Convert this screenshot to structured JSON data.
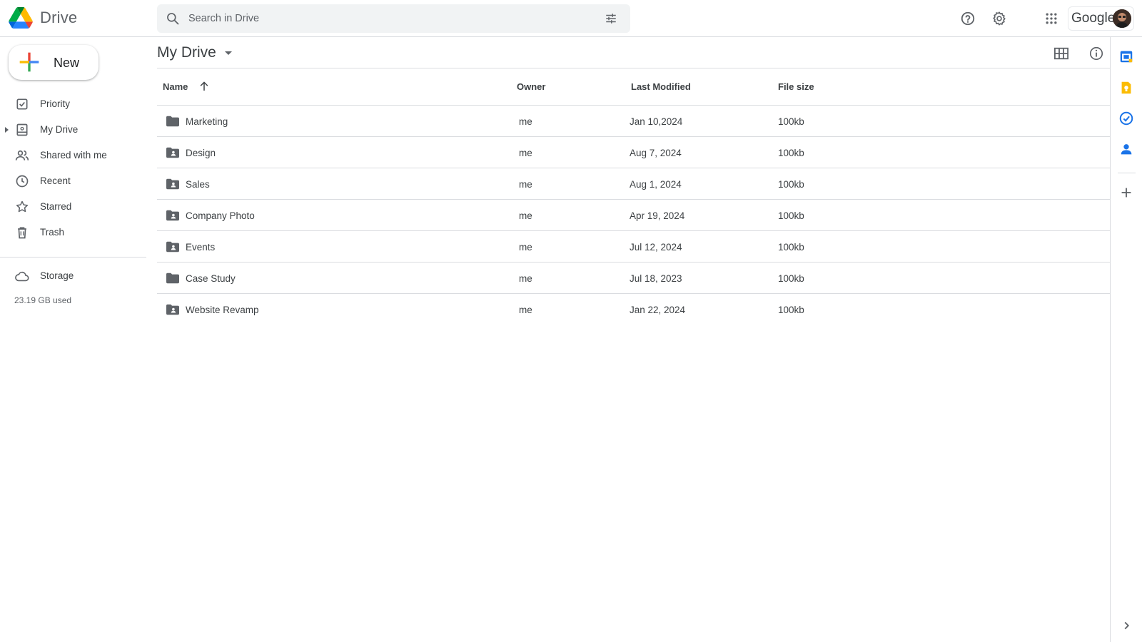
{
  "header": {
    "app_name": "Drive",
    "search_placeholder": "Search in Drive",
    "account_label": "Google"
  },
  "sidebar": {
    "new_label": "New",
    "items": [
      {
        "label": "Priority",
        "icon": "priority-icon"
      },
      {
        "label": "My Drive",
        "icon": "my-drive-icon"
      },
      {
        "label": "Shared with me",
        "icon": "shared-icon"
      },
      {
        "label": "Recent",
        "icon": "clock-icon"
      },
      {
        "label": "Starred",
        "icon": "star-icon"
      },
      {
        "label": "Trash",
        "icon": "trash-icon"
      }
    ],
    "storage_label": "Storage",
    "storage_used": "23.19 GB used"
  },
  "main": {
    "title": "My Drive",
    "columns": {
      "name": "Name",
      "owner": "Owner",
      "modified": "Last Modified",
      "size": "File size"
    },
    "rows": [
      {
        "name": "Marketing",
        "owner": "me",
        "modified": "Jan 10,2024",
        "size": "100kb",
        "shared": false
      },
      {
        "name": "Design",
        "owner": "me",
        "modified": "Aug 7, 2024",
        "size": "100kb",
        "shared": true
      },
      {
        "name": "Sales",
        "owner": "me",
        "modified": "Aug 1, 2024",
        "size": "100kb",
        "shared": true
      },
      {
        "name": "Company Photo",
        "owner": "me",
        "modified": "Apr 19, 2024",
        "size": "100kb",
        "shared": true
      },
      {
        "name": "Events",
        "owner": "me",
        "modified": "Jul 12, 2024",
        "size": "100kb",
        "shared": true
      },
      {
        "name": "Case Study",
        "owner": "me",
        "modified": "Jul 18, 2023",
        "size": "100kb",
        "shared": false
      },
      {
        "name": "Website Revamp",
        "owner": "me",
        "modified": "Jan 22, 2024",
        "size": "100kb",
        "shared": true
      }
    ]
  },
  "colors": {
    "blue": "#1a73e8",
    "yellow": "#fbbc04",
    "green": "#34a853",
    "red": "#ea4335",
    "icon_gray": "#5f6368"
  }
}
